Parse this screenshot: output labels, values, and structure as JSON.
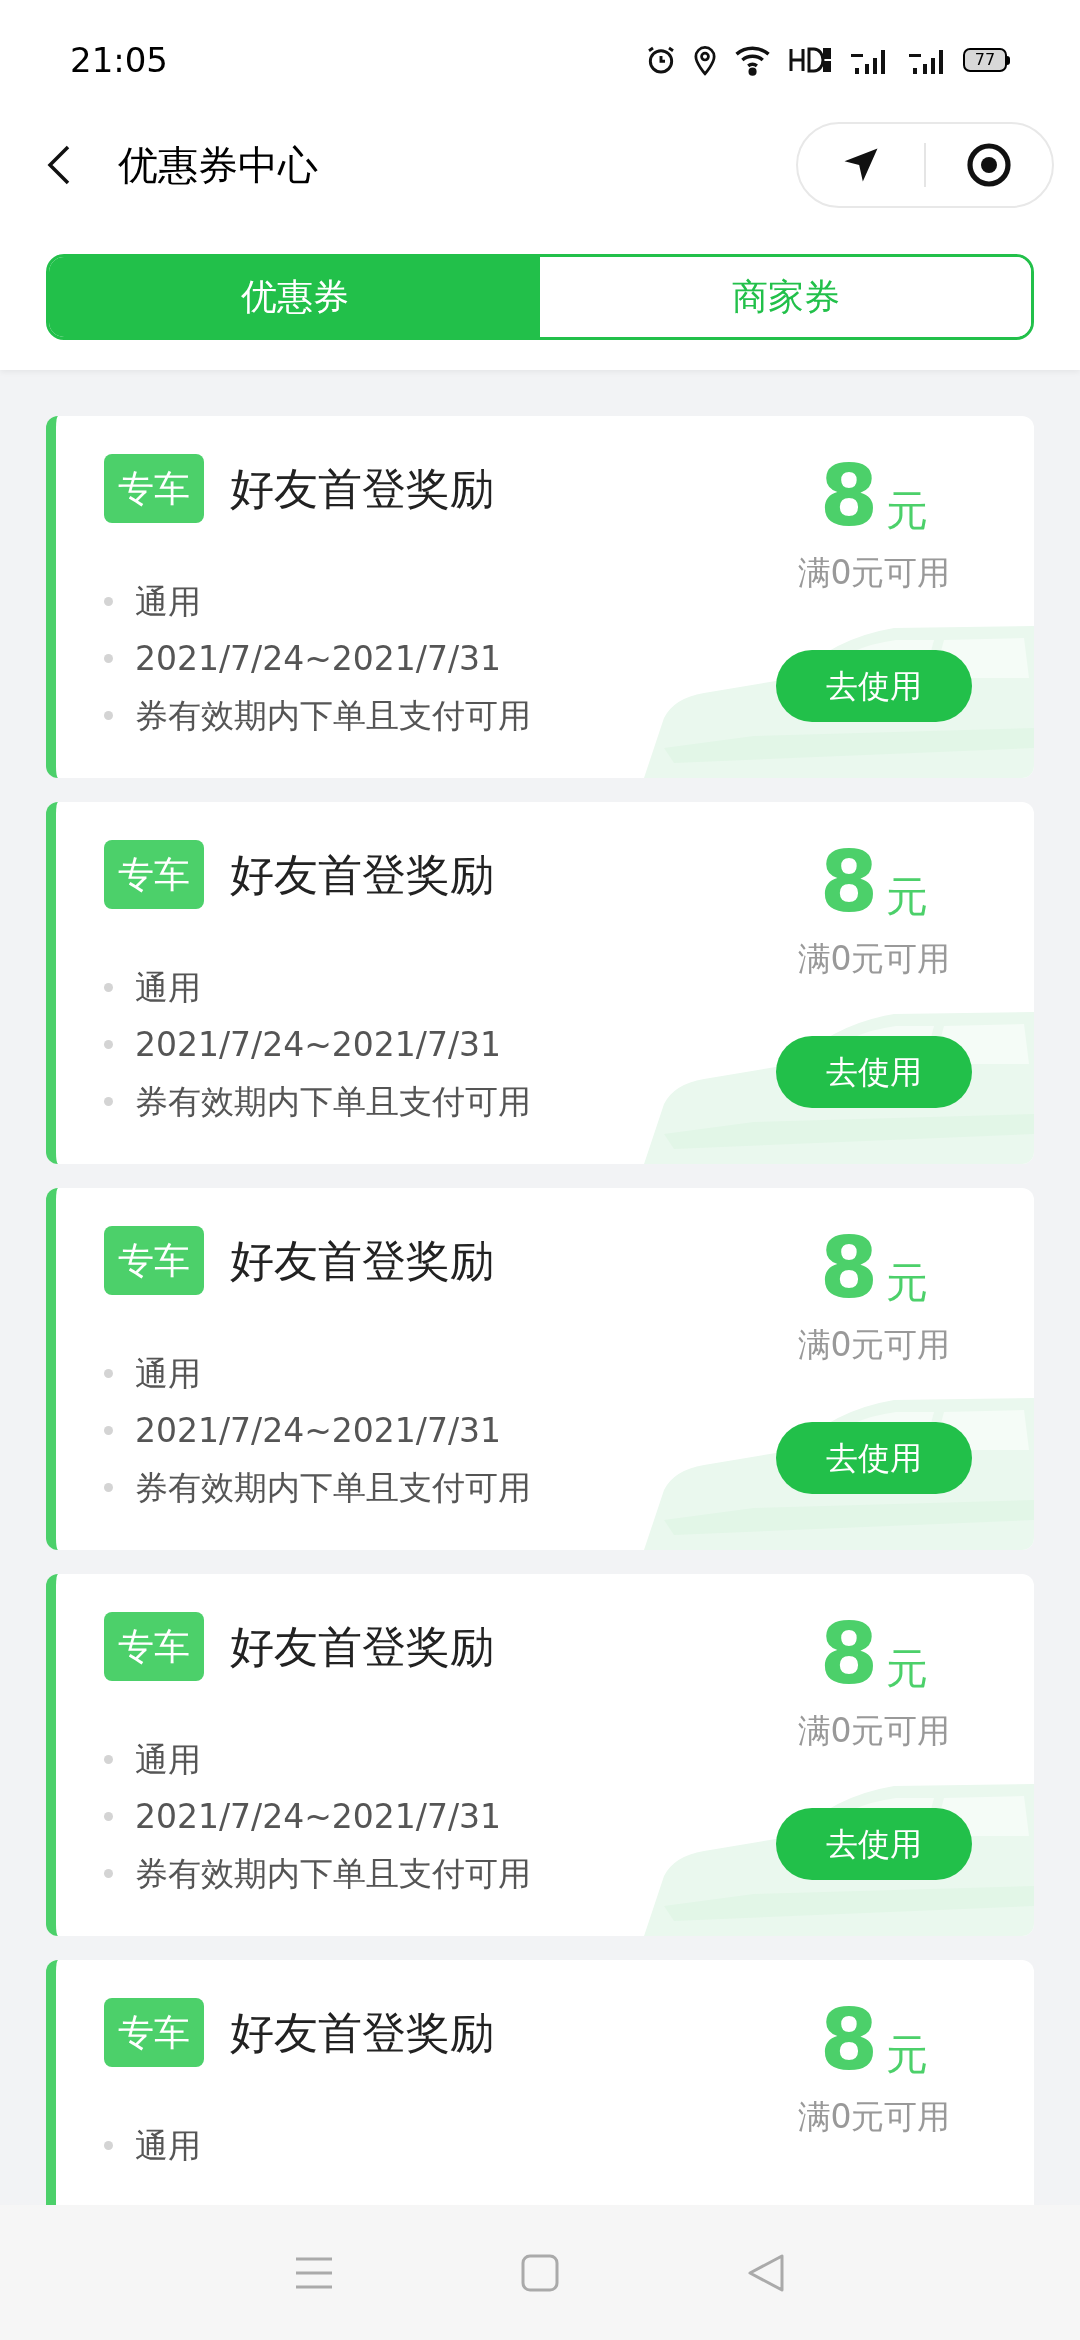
{
  "status_bar": {
    "time": "21:05",
    "battery": "77"
  },
  "header": {
    "title": "优惠券中心"
  },
  "tabs": [
    {
      "label": "优惠券",
      "selected": true
    },
    {
      "label": "商家券",
      "selected": false
    }
  ],
  "coupons": [
    {
      "tag": "专车",
      "title": "好友首登奖励",
      "amount": "8",
      "unit": "元",
      "condition": "满0元可用",
      "items": [
        "通用",
        "2021/7/24~2021/7/31",
        "券有效期内下单且支付可用"
      ],
      "button": "去使用"
    },
    {
      "tag": "专车",
      "title": "好友首登奖励",
      "amount": "8",
      "unit": "元",
      "condition": "满0元可用",
      "items": [
        "通用",
        "2021/7/24~2021/7/31",
        "券有效期内下单且支付可用"
      ],
      "button": "去使用"
    },
    {
      "tag": "专车",
      "title": "好友首登奖励",
      "amount": "8",
      "unit": "元",
      "condition": "满0元可用",
      "items": [
        "通用",
        "2021/7/24~2021/7/31",
        "券有效期内下单且支付可用"
      ],
      "button": "去使用"
    },
    {
      "tag": "专车",
      "title": "好友首登奖励",
      "amount": "8",
      "unit": "元",
      "condition": "满0元可用",
      "items": [
        "通用",
        "2021/7/24~2021/7/31",
        "券有效期内下单且支付可用"
      ],
      "button": "去使用"
    },
    {
      "tag": "专车",
      "title": "好友首登奖励",
      "amount": "8",
      "unit": "元",
      "condition": "满0元可用",
      "items": [
        "通用"
      ]
    }
  ]
}
